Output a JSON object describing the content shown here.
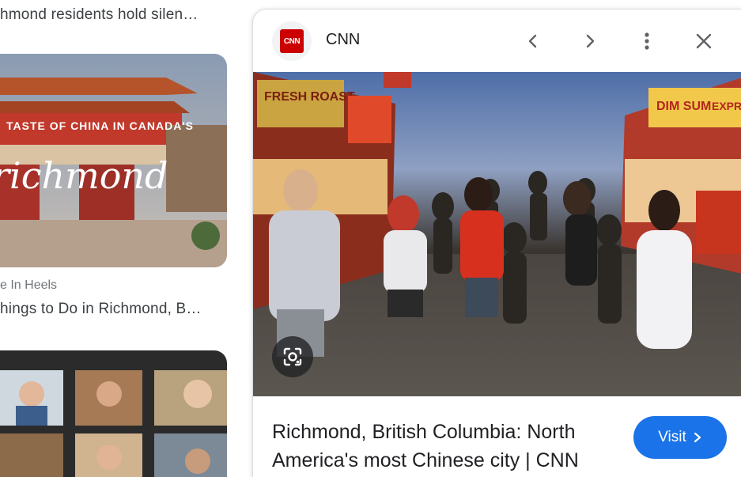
{
  "results": [
    {
      "title": "hmond residents hold silen…"
    },
    {
      "source": "e In Heels",
      "title": "hings to Do in Richmond, B…",
      "thumb_text": {
        "banner": "TASTE OF CHINA IN CANADA'S",
        "script": "richmond"
      }
    }
  ],
  "panel": {
    "logo_text": "CNN",
    "site_name": "CNN",
    "caption": "Richmond, British Columbia: North America's most Chinese city | CNN",
    "visit_label": "Visit",
    "photo_signs": [
      "FRESH ROAST",
      "DIM SUM",
      "EXPRESS"
    ]
  },
  "colors": {
    "accent": "#1a73e8",
    "cnn_red": "#cc0000"
  },
  "icons": [
    "chevron-left-icon",
    "chevron-right-icon",
    "more-vert-icon",
    "close-icon",
    "lens-icon",
    "chevron-right-small-icon"
  ]
}
